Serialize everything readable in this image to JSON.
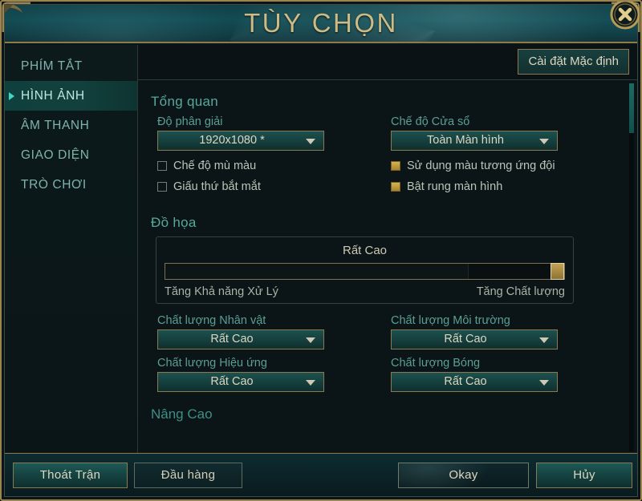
{
  "window": {
    "title": "TÙY CHỌN",
    "close_icon": "close-icon"
  },
  "sidebar": {
    "items": [
      {
        "label": "PHÍM TẮT",
        "selected": false
      },
      {
        "label": "HÌNH ẢNH",
        "selected": true
      },
      {
        "label": "ÂM THANH",
        "selected": false
      },
      {
        "label": "GIAO DIỆN",
        "selected": false
      },
      {
        "label": "TRÒ CHƠI",
        "selected": false
      }
    ]
  },
  "topbar": {
    "default_settings_label": "Cài đặt Mặc định"
  },
  "overview": {
    "section_title": "Tổng quan",
    "resolution": {
      "label": "Độ phân giải",
      "value": "1920x1080 *"
    },
    "window_mode": {
      "label": "Chế độ Cửa sổ",
      "value": "Toàn Màn hình"
    },
    "checkboxes": [
      {
        "label": "Chế độ mù màu",
        "checked": false
      },
      {
        "label": "Giấu thứ bắt mắt",
        "checked": false
      },
      {
        "label": "Sử dụng màu tương ứng đội",
        "checked": true
      },
      {
        "label": "Bật rung màn hình",
        "checked": true
      }
    ]
  },
  "graphics": {
    "section_title": "Đồ họa",
    "preset_value": "Rất Cao",
    "slider_percent": 100,
    "left_end_label": "Tăng Khả năng Xử Lý",
    "right_end_label": "Tăng Chất lượng",
    "quality": [
      {
        "label": "Chất lượng Nhân vật",
        "value": "Rất Cao"
      },
      {
        "label": "Chất lượng Môi trường",
        "value": "Rất Cao"
      },
      {
        "label": "Chất lượng Hiệu ứng",
        "value": "Rất Cao"
      },
      {
        "label": "Chất lượng Bóng",
        "value": "Rất Cao"
      }
    ]
  },
  "advanced": {
    "section_title": "Nâng Cao"
  },
  "footer": {
    "exit_label": "Thoát Trận",
    "surrender_label": "Đầu hàng",
    "okay_label": "Okay",
    "cancel_label": "Hủy"
  },
  "colors": {
    "gold": "#cdbb85",
    "gold_border": "#8a7a52",
    "teal": "#57a99c",
    "accent_arrow": "#3fd6c2",
    "background": "#0b1417"
  }
}
